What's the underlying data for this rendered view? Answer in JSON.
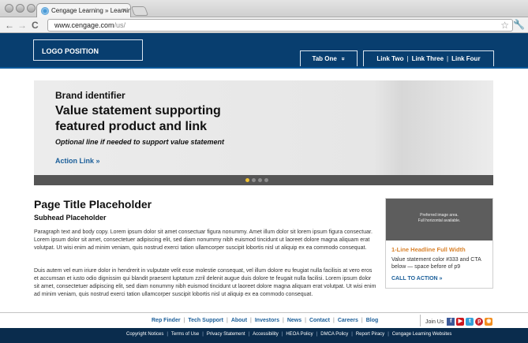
{
  "browser": {
    "tab_title": "Cengage Learning » Learnin",
    "tab_close": "×",
    "url_host": "www.cengage.com",
    "url_path": "/us/",
    "back": "←",
    "forward": "→",
    "reload": "C"
  },
  "header": {
    "logo": "LOGO POSITION",
    "tab_one": "Tab One",
    "tab_one_chevron": "»",
    "links": [
      "Link Two",
      "Link Three",
      "Link Four"
    ],
    "link_separator": "|"
  },
  "hero": {
    "brand": "Brand identifier",
    "value": "Value statement supporting featured product and link",
    "optional": "Optional line if needed to support value statement",
    "action": "Action Link »",
    "active_slide": 0,
    "slide_count": 4,
    "dot_active_color": "#f1c232"
  },
  "main": {
    "title": "Page Title Placeholder",
    "subhead": "Subhead Placeholder",
    "para1": "Paragraph text and body copy. Lorem ipsum dolor sit amet consectuar figura nonummy. Amet illum dolor sit lorem ipsum figura consectuar. Lorem ipsum dolor sit amet, consectetuer adipiscing elit, sed diam nonummy nibh euismod tincidunt ut laoreet dolore magna aliquam erat volutpat. Ut wisi enim ad minim veniam, quis nostrud exerci tation ullamcorper suscipit lobortis nisl ut aliquip ex ea commodo consequat.",
    "para2": "Duis autem vel eum iriure dolor in hendrerit in vulputate velit esse molestie consequat, vel illum dolore eu feugiat nulla facilisis at vero eros et accumsan et iusto odio dignissim qui blandit praesent luptatum zzril delenit augue duis dolore te feugait nulla facilisi. Lorem ipsum dolor sit amet, consectetuer adipiscing elit, sed diam nonummy nibh euismod tincidunt ut laoreet dolore magna aliquam erat volutpat. Ut wisi enim ad minim veniam, quis nostrud exerci tation ullamcorper suscipit lobortis nisl ut aliquip ex ea commodo consequat."
  },
  "promo": {
    "image_text_1": "Preferred image area.",
    "image_text_2": "Full horizontal available.",
    "headline": "1-Line Headline Full Width",
    "text": "Value statement color #333 and CTA below — space before of p9",
    "cta": "CALL TO ACTION »",
    "headline_color": "#d9822b"
  },
  "footer": {
    "links": [
      "Rep Finder",
      "Tech Support",
      "About",
      "Investors",
      "News",
      "Contact",
      "Careers",
      "Blog"
    ],
    "join": "Join Us",
    "social": [
      "facebook-icon",
      "youtube-icon",
      "twitter-icon",
      "pinterest-icon",
      "rss-icon"
    ],
    "legal": [
      "Copyright Notices",
      "Terms of Use",
      "Privacy Statement",
      "Accessibility",
      "HEOA Policy",
      "DMCA Policy",
      "Report Piracy",
      "Cengage Learning Websites"
    ]
  },
  "colors": {
    "header_bg": "#083e6f",
    "link_blue": "#1a5e99",
    "footer_bg": "#0a2c4d"
  }
}
